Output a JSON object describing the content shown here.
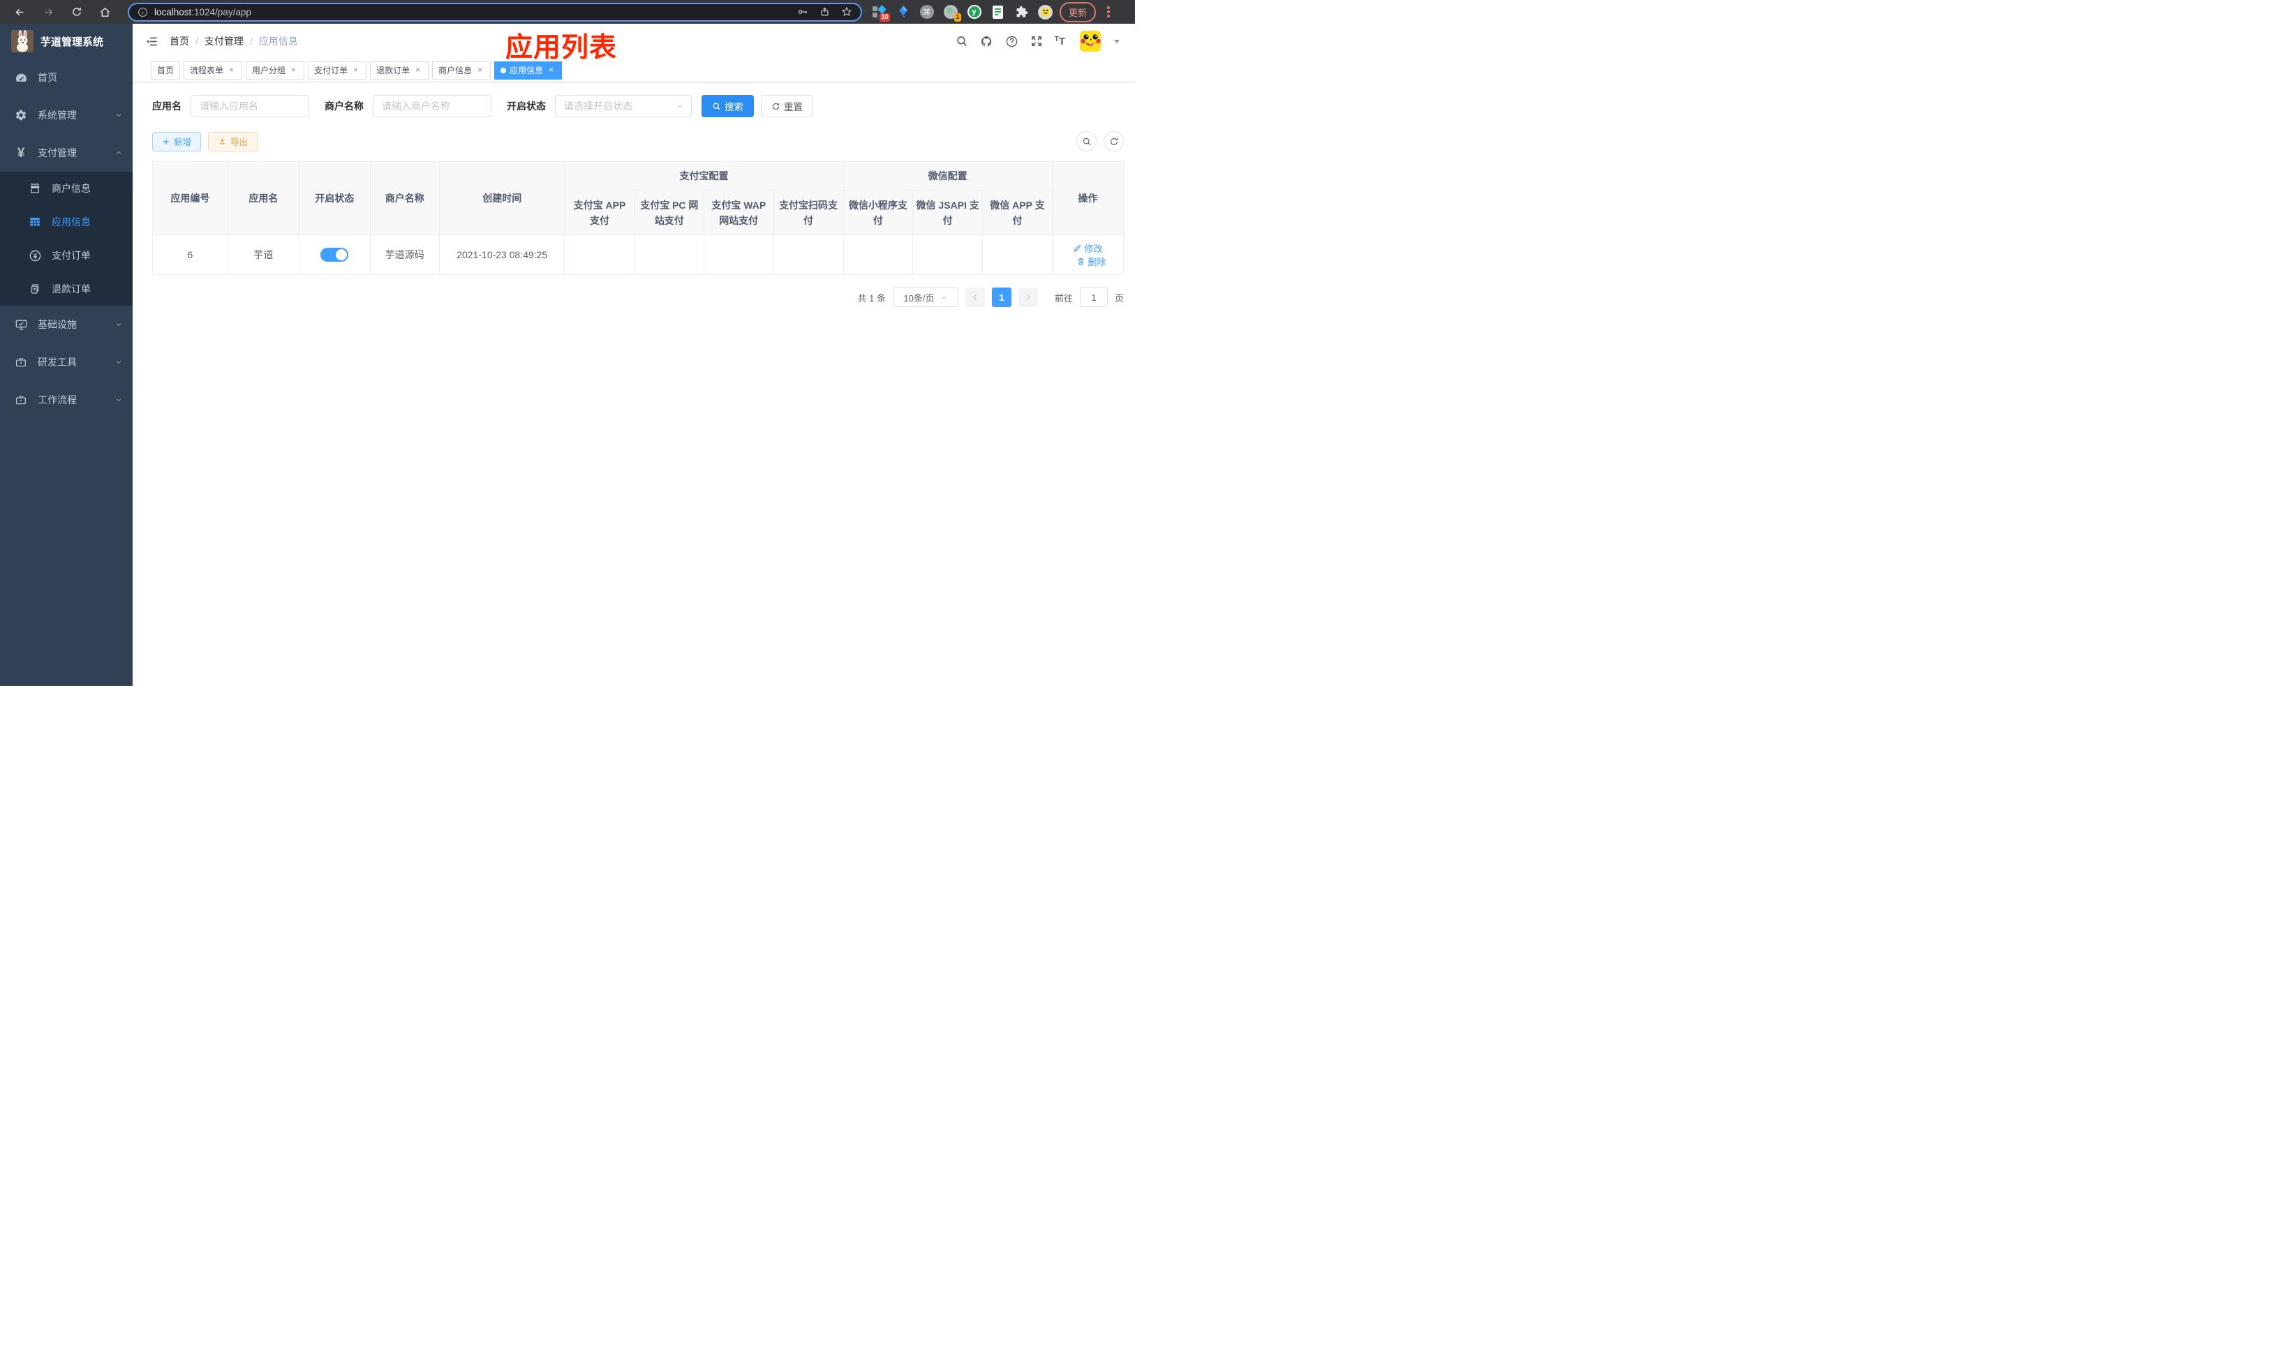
{
  "colors": {
    "primary": "#409EFF",
    "danger": "#f4494d",
    "success": "#0fc160",
    "warning": "#E6A23C",
    "sidebar_bg": "#304156",
    "submenu_bg": "#1f2d3d",
    "annotation": "#ff2600"
  },
  "browser": {
    "url_host": "localhost",
    "url_path": ":1024/pay/app",
    "update_label": "更新",
    "ext_badge_blue": "10",
    "ext_badge_gray": "1"
  },
  "sidebar": {
    "title": "芋道管理系统",
    "menu": [
      {
        "label": "首页"
      },
      {
        "label": "系统管理"
      },
      {
        "label": "支付管理"
      },
      {
        "label": "商户信息"
      },
      {
        "label": "应用信息"
      },
      {
        "label": "支付订单"
      },
      {
        "label": "退款订单"
      },
      {
        "label": "基础设施"
      },
      {
        "label": "研发工具"
      },
      {
        "label": "工作流程"
      }
    ]
  },
  "header": {
    "breadcrumb": [
      "首页",
      "支付管理",
      "应用信息"
    ],
    "annotation": "应用列表"
  },
  "tabs": [
    {
      "label": "首页"
    },
    {
      "label": "流程表单"
    },
    {
      "label": "用户分组"
    },
    {
      "label": "支付订单"
    },
    {
      "label": "退款订单"
    },
    {
      "label": "商户信息"
    },
    {
      "label": "应用信息"
    }
  ],
  "filters": {
    "app_name_label": "应用名",
    "app_name_placeholder": "请输入应用名",
    "merchant_label": "商户名称",
    "merchant_placeholder": "请输入商户名称",
    "status_label": "开启状态",
    "status_placeholder": "请选择开启状态",
    "search_label": "搜索",
    "reset_label": "重置"
  },
  "toolbar": {
    "add_label": "新增",
    "export_label": "导出"
  },
  "table": {
    "columns": {
      "app_id": "应用编号",
      "app_name": "应用名",
      "status": "开启状态",
      "merchant": "商户名称",
      "created": "创建时间",
      "group_alipay": "支付宝配置",
      "group_wechat": "微信配置",
      "alipay_app": "支付宝 APP 支付",
      "alipay_pc": "支付宝 PC 网站支付",
      "alipay_wap": "支付宝 WAP 网站支付",
      "alipay_scan": "支付宝扫码支付",
      "wx_mini": "微信小程序支付",
      "wx_jsapi": "微信 JSAPI 支付",
      "wx_app": "微信 APP 支付",
      "actions": "操作"
    },
    "rows": [
      {
        "app_id": "6",
        "app_name": "芋道",
        "enabled": true,
        "merchant": "芋道源码",
        "created": "2021-10-23 08:49:25",
        "pay_status": [
          "no",
          "no",
          "no",
          "no",
          "no",
          "yes",
          "no"
        ],
        "edit_label": "修改",
        "delete_label": "删除"
      }
    ]
  },
  "pagination": {
    "total": "共 1 条",
    "page_size": "10条/页",
    "page": "1",
    "goto_label": "前往",
    "goto_value": "1",
    "goto_suffix": "页"
  }
}
